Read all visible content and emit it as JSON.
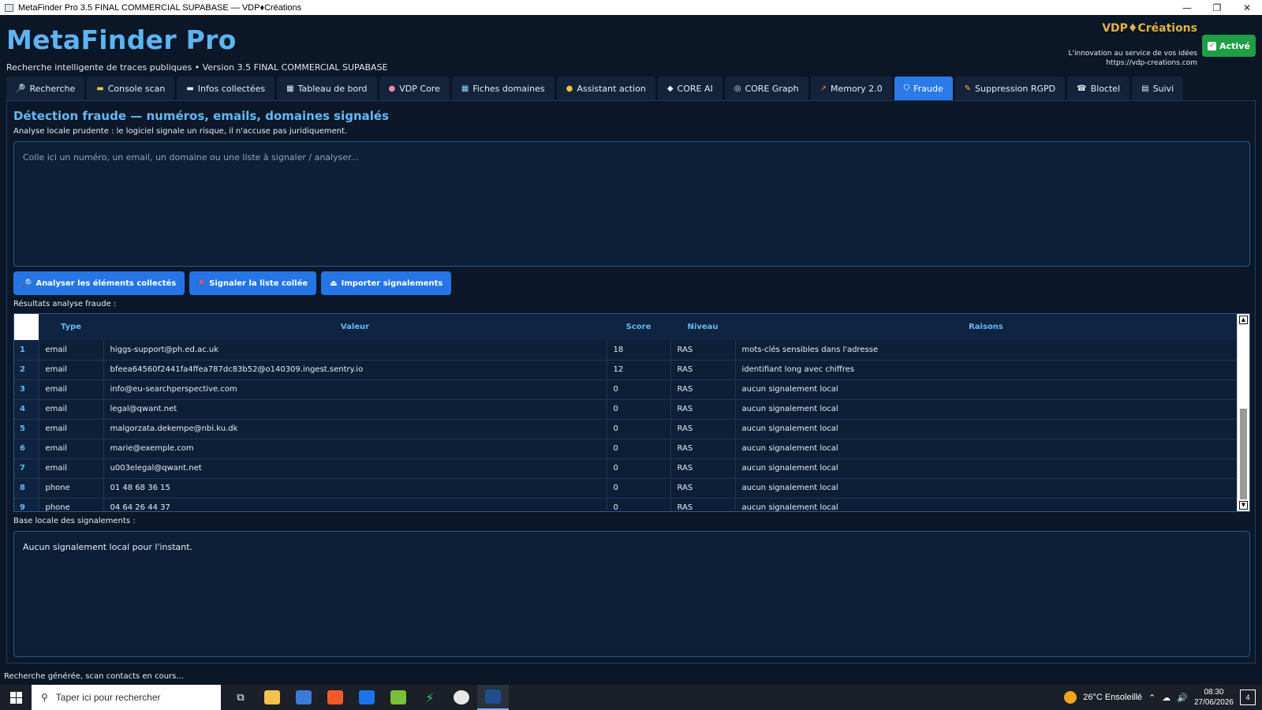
{
  "window": {
    "title": "MetaFinder Pro 3.5 FINAL COMMERCIAL SUPABASE — VDP♦Créations",
    "controls": [
      "—",
      "❐",
      "✕"
    ]
  },
  "header": {
    "brand": "MetaFinder Pro",
    "subtitle": "Recherche intelligente de traces publiques • Version 3.5 FINAL COMMERCIAL SUPABASE",
    "vdp_logo": "VDP♦Créations",
    "vdp_tagline": "L'innovation au service de vos idées",
    "vdp_url": "https://vdp-creations.com",
    "active_label": "Activé"
  },
  "tabs": [
    {
      "label": "Recherche",
      "icon": "🔎"
    },
    {
      "label": "Console scan",
      "icon": "▬"
    },
    {
      "label": "Infos collectées",
      "icon": "▬"
    },
    {
      "label": "Tableau de bord",
      "icon": "▦"
    },
    {
      "label": "VDP Core",
      "icon": "●"
    },
    {
      "label": "Fiches domaines",
      "icon": "▦"
    },
    {
      "label": "Assistant action",
      "icon": "●"
    },
    {
      "label": "CORE AI",
      "icon": "◆"
    },
    {
      "label": "CORE Graph",
      "icon": "◎"
    },
    {
      "label": "Memory 2.0",
      "icon": "↗"
    },
    {
      "label": "Fraude",
      "icon": "⛉"
    },
    {
      "label": "Suppression RGPD",
      "icon": "✎"
    },
    {
      "label": "Bloctel",
      "icon": "☎"
    },
    {
      "label": "Suivi",
      "icon": "▤"
    }
  ],
  "active_tab": "Fraude",
  "fraud": {
    "title": "Détection fraude — numéros, emails, domaines signalés",
    "hint": "Analyse locale prudente : le logiciel signale un risque, il n'accuse pas juridiquement.",
    "input_placeholder": "Colle ici un numéro, un email, un domaine ou une liste à signaler / analyser...",
    "buttons": {
      "analyze": "Analyser les éléments collectés",
      "report": "Signaler la liste collée",
      "import": "Importer signalements"
    },
    "results_label": "Résultats analyse fraude :",
    "columns": [
      "Type",
      "Valeur",
      "Score",
      "Niveau",
      "Raisons"
    ],
    "rows": [
      {
        "idx": "1",
        "type": "email",
        "value": "higgs-support@ph.ed.ac.uk",
        "score": "18",
        "level": "RAS",
        "reason": "mots-clés sensibles dans l'adresse"
      },
      {
        "idx": "2",
        "type": "email",
        "value": "bfeea64560f2441fa4ffea787dc83b52@o140309.ingest.sentry.io",
        "score": "12",
        "level": "RAS",
        "reason": "identifiant long avec chiffres"
      },
      {
        "idx": "3",
        "type": "email",
        "value": "info@eu-searchperspective.com",
        "score": "0",
        "level": "RAS",
        "reason": "aucun signalement local"
      },
      {
        "idx": "4",
        "type": "email",
        "value": "legal@qwant.net",
        "score": "0",
        "level": "RAS",
        "reason": "aucun signalement local"
      },
      {
        "idx": "5",
        "type": "email",
        "value": "malgorzata.dekempe@nbi.ku.dk",
        "score": "0",
        "level": "RAS",
        "reason": "aucun signalement local"
      },
      {
        "idx": "6",
        "type": "email",
        "value": "marie@exemple.com",
        "score": "0",
        "level": "RAS",
        "reason": "aucun signalement local"
      },
      {
        "idx": "7",
        "type": "email",
        "value": "u003elegal@qwant.net",
        "score": "0",
        "level": "RAS",
        "reason": "aucun signalement local"
      },
      {
        "idx": "8",
        "type": "phone",
        "value": "01 48 68 36 15",
        "score": "0",
        "level": "RAS",
        "reason": "aucun signalement local"
      },
      {
        "idx": "9",
        "type": "phone",
        "value": "04 64 26 44 37",
        "score": "0",
        "level": "RAS",
        "reason": "aucun signalement local"
      }
    ],
    "base_label": "Base locale des signalements :",
    "base_text": "Aucun signalement local pour l'instant."
  },
  "status": "Recherche générée, scan contacts en cours...",
  "taskbar": {
    "search_placeholder": "Taper ici pour rechercher",
    "weather": "26°C  Ensoleillé",
    "time": "08:30",
    "date": "27/06/2026",
    "notifications": "4"
  }
}
